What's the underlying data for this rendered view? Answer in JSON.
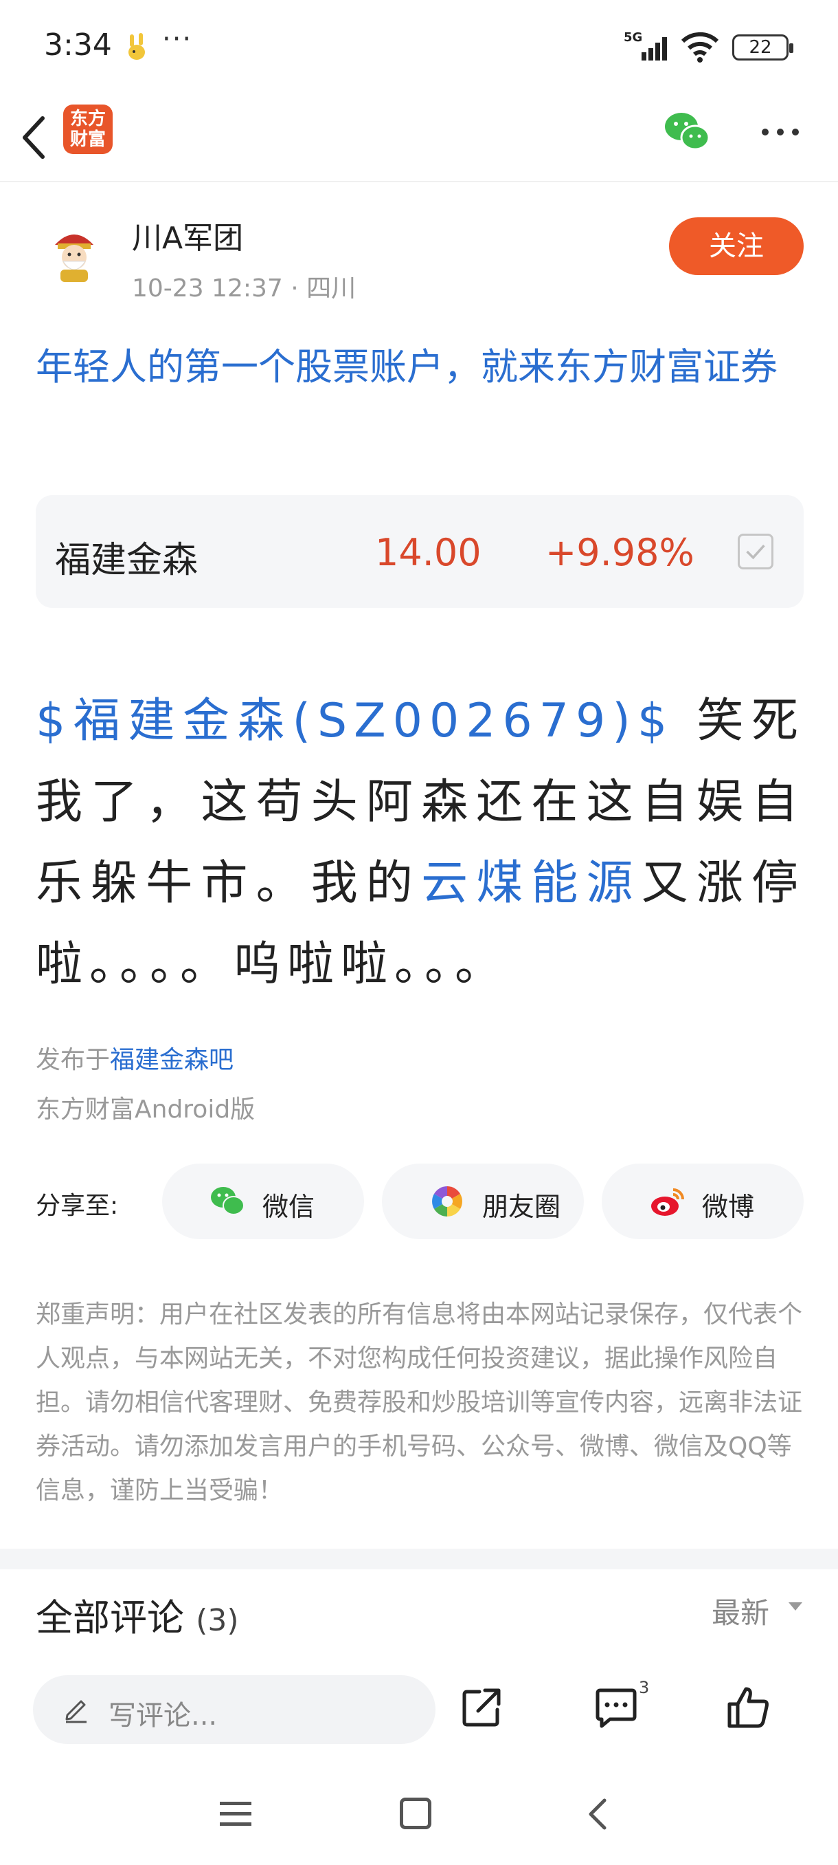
{
  "status_bar": {
    "time": "3:34",
    "more": "···",
    "network": "5G",
    "battery": "22"
  },
  "nav": {
    "logo_line1": "东方",
    "logo_line2": "财富"
  },
  "author": {
    "name": "川A军团",
    "meta": "10-23 12:37 · 四川",
    "follow_label": "关注"
  },
  "ad_link": "年轻人的第一个股票账户，就来东方财富证券",
  "stock": {
    "name": "福建金森",
    "price": "14.00",
    "change": "+9.98%"
  },
  "post": {
    "stock_tag": "$福建金森(SZ002679)$",
    "text1": " 笑死我了，这苟头阿森还在这自娱自乐躲牛市。我的",
    "topic": "云煤能源",
    "text2": "又涨停啦。。。。呜啦啦。。。"
  },
  "published": {
    "prefix": "发布于",
    "bar_name": "福建金森吧",
    "client": "东方财富Android版"
  },
  "share": {
    "label": "分享至:",
    "wechat": "微信",
    "moments": "朋友圈",
    "weibo": "微博"
  },
  "disclaimer": "郑重声明：用户在社区发表的所有信息将由本网站记录保存，仅代表个人观点，与本网站无关，不对您构成任何投资建议，据此操作风险自担。请勿相信代客理财、免费荐股和炒股培训等宣传内容，远离非法证券活动。请勿添加发言用户的手机号码、公众号、微博、微信及QQ等信息，谨防上当受骗！",
  "comments": {
    "title": "全部评论",
    "count": "(3)",
    "sort": "最新"
  },
  "bottom_bar": {
    "input_placeholder": "写评论...",
    "comment_badge": "3"
  },
  "colors": {
    "accent": "#ef5a28",
    "link": "#2a6ed0",
    "price_up": "#d9482b"
  },
  "icons": [
    "back-icon",
    "wechat-icon",
    "more-icon",
    "checkbox-icon",
    "moments-icon",
    "weibo-icon",
    "pen-icon",
    "share-icon",
    "comment-icon",
    "like-icon"
  ]
}
